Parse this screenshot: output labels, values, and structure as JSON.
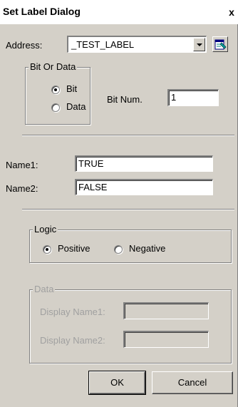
{
  "dialog": {
    "title": "Set Label Dialog",
    "close_glyph": "x"
  },
  "address": {
    "label": "Address:",
    "value": "_TEST_LABEL"
  },
  "bit_or_data": {
    "title": "Bit Or Data",
    "options": [
      "Bit",
      "Data"
    ],
    "selected": "Bit"
  },
  "bit_num": {
    "label": "Bit Num.",
    "value": "1"
  },
  "names": {
    "name1_label": "Name1:",
    "name1_value": "TRUE",
    "name2_label": "Name2:",
    "name2_value": "FALSE"
  },
  "logic": {
    "title": "Logic",
    "options": [
      "Positive",
      "Negative"
    ],
    "selected": "Positive"
  },
  "data_group": {
    "title": "Data",
    "display_name1_label": "Display Name1:",
    "display_name2_label": "Display Name2:",
    "display_name1_value": "",
    "display_name2_value": "",
    "enabled": false
  },
  "buttons": {
    "ok": "OK",
    "cancel": "Cancel"
  },
  "icons": {
    "browse": "browse-tag-icon",
    "close": "close-icon",
    "dropdown": "chevron-down-icon"
  }
}
